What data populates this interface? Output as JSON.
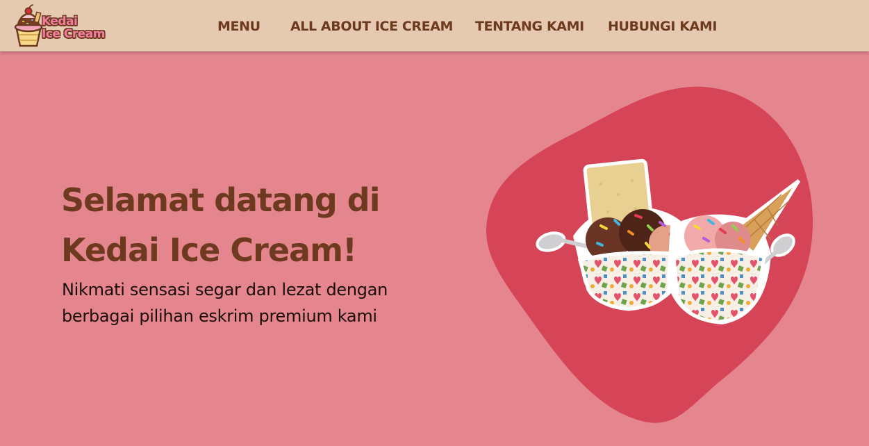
{
  "brand": {
    "logo_line1": "Kedai",
    "logo_line2": "Ice Cream",
    "logo_icon": "ice-cream-sundae-icon"
  },
  "nav": {
    "items": [
      {
        "label": "MENU"
      },
      {
        "label": "ALL ABOUT ICE CREAM"
      },
      {
        "label": "TENTANG KAMI"
      },
      {
        "label": "HUBUNGI KAMI"
      }
    ]
  },
  "hero": {
    "title_line1": "Selamat datang di",
    "title_line2": "Kedai Ice Cream!",
    "subtitle_line1": "Nikmati sensasi segar dan lezat dengan",
    "subtitle_line2": "berbagai pilihan eskrim premium kami",
    "image": "ice-cream-cups-image"
  },
  "colors": {
    "navbar_bg": "#e5c9b0",
    "page_bg": "#e5868f",
    "blob": "#d64457",
    "brown_text": "#6d3a1f"
  }
}
